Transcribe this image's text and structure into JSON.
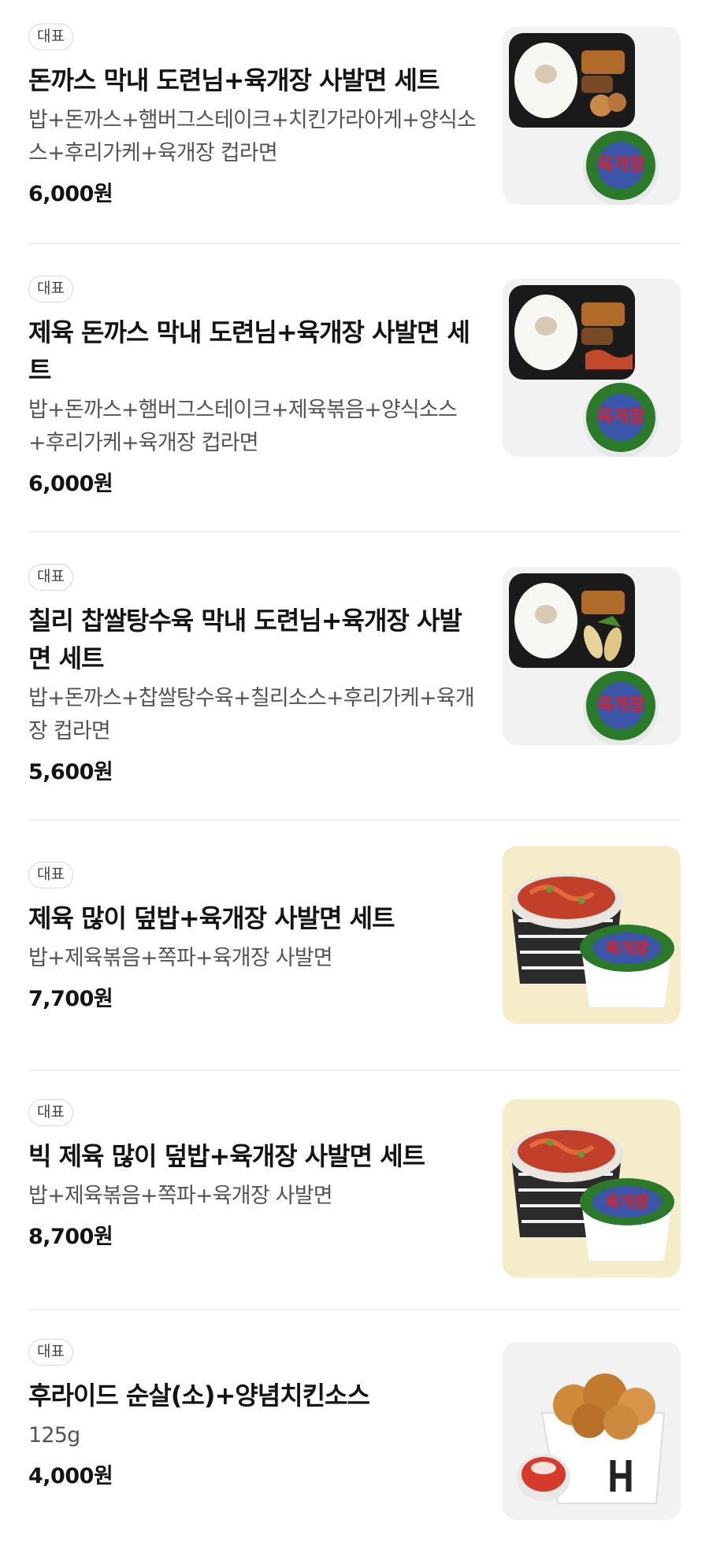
{
  "items": [
    {
      "badge": "대표",
      "name": "돈까스 막내 도련님+육개장 사발면 세트",
      "desc": "밥+돈까스+햄버그스테이크+치킨가라아게+양식소스+후리가케+육개장 컵라면",
      "price": "6,000원",
      "image": "lunchbox-with-ramen-cup"
    },
    {
      "badge": "대표",
      "name": "제육 돈까스 막내 도련님+육개장 사발면 세트",
      "desc": "밥+돈까스+햄버그스테이크+제육볶음+양식소스+후리가케+육개장 컵라면",
      "price": "6,000원",
      "image": "lunchbox-with-ramen-cup"
    },
    {
      "badge": "대표",
      "name": "칠리 찹쌀탕수육 막내 도련님+육개장 사발면 세트",
      "desc": "밥+돈까스+찹쌀탕수육+칠리소스+후리가케+육개장 컵라면",
      "price": "5,600원",
      "image": "lunchbox-with-ramen-cup"
    },
    {
      "badge": "대표",
      "name": "제육 많이 덮밥+육개장 사발면 세트",
      "desc": "밥+제육볶음+쪽파+육개장 사발면",
      "price": "7,700원",
      "image": "rice-bowl-with-ramen-cup"
    },
    {
      "badge": "대표",
      "name": "빅 제육 많이 덮밥+육개장 사발면 세트",
      "desc": "밥+제육볶음+쪽파+육개장 사발면",
      "price": "8,700원",
      "image": "rice-bowl-with-ramen-cup"
    },
    {
      "badge": "대표",
      "name": "후라이드 순살(소)+양념치킨소스",
      "desc": "125g",
      "price": "4,000원",
      "image": "fried-chicken-box"
    }
  ],
  "colors": {
    "badge_border": "#d9d9d9",
    "thumb_gray": "#f2f2f2",
    "thumb_cream": "#f5ecc9",
    "divider": "#efefef",
    "ramen_label": "#2a7a2a",
    "ramen_text": "#e02020"
  }
}
